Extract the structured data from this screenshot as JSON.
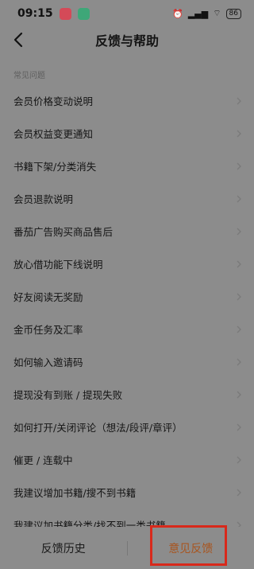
{
  "status_bar": {
    "time": "09:15",
    "battery": "86",
    "app_icon_colors": [
      "#d44a58",
      "#3ea778"
    ]
  },
  "nav": {
    "title": "反馈与帮助",
    "back_icon": "chevron-left-icon"
  },
  "section": {
    "title": "常见问题"
  },
  "faq_items": [
    {
      "label": "会员价格变动说明"
    },
    {
      "label": "会员权益变更通知"
    },
    {
      "label": "书籍下架/分类消失"
    },
    {
      "label": "会员退款说明"
    },
    {
      "label": "番茄广告购买商品售后"
    },
    {
      "label": "放心借功能下线说明"
    },
    {
      "label": "好友阅读无奖励"
    },
    {
      "label": "金币任务及汇率"
    },
    {
      "label": "如何输入邀请码"
    },
    {
      "label": "提现没有到账 / 提现失败"
    },
    {
      "label": "如何打开/关闭评论（想法/段评/章评）"
    },
    {
      "label": "催更 / 连载中"
    },
    {
      "label": "我建议增加书籍/搜不到书籍"
    },
    {
      "label": "我建议加书籍分类/找不到一类书籍"
    }
  ],
  "bottom_bar": {
    "history_label": "反馈历史",
    "feedback_label": "意见反馈"
  },
  "colors": {
    "overlay_bg": "#8c8c8c",
    "feedback_accent": "#a8551f",
    "highlight": "#d8291b"
  }
}
